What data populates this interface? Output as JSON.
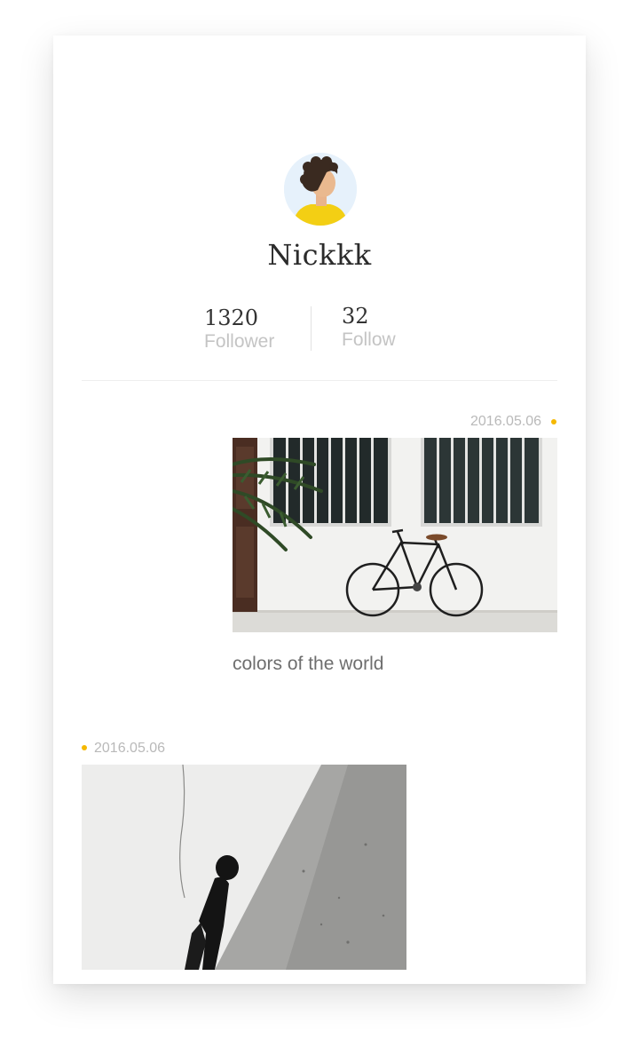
{
  "profile": {
    "name": "Nickkk",
    "avatar_icon": "avatar-woman-yellow-shirt"
  },
  "stats": {
    "follower_count": "1320",
    "follower_label": "Follower",
    "follow_count": "32",
    "follow_label": "Follow"
  },
  "accent_color": "#f5b800",
  "posts": [
    {
      "date": "2016.05.06",
      "caption": "colors of the world",
      "image": "bicycle-against-white-wall"
    },
    {
      "date": "2016.05.06",
      "image": "person-leaning-on-wall"
    }
  ]
}
